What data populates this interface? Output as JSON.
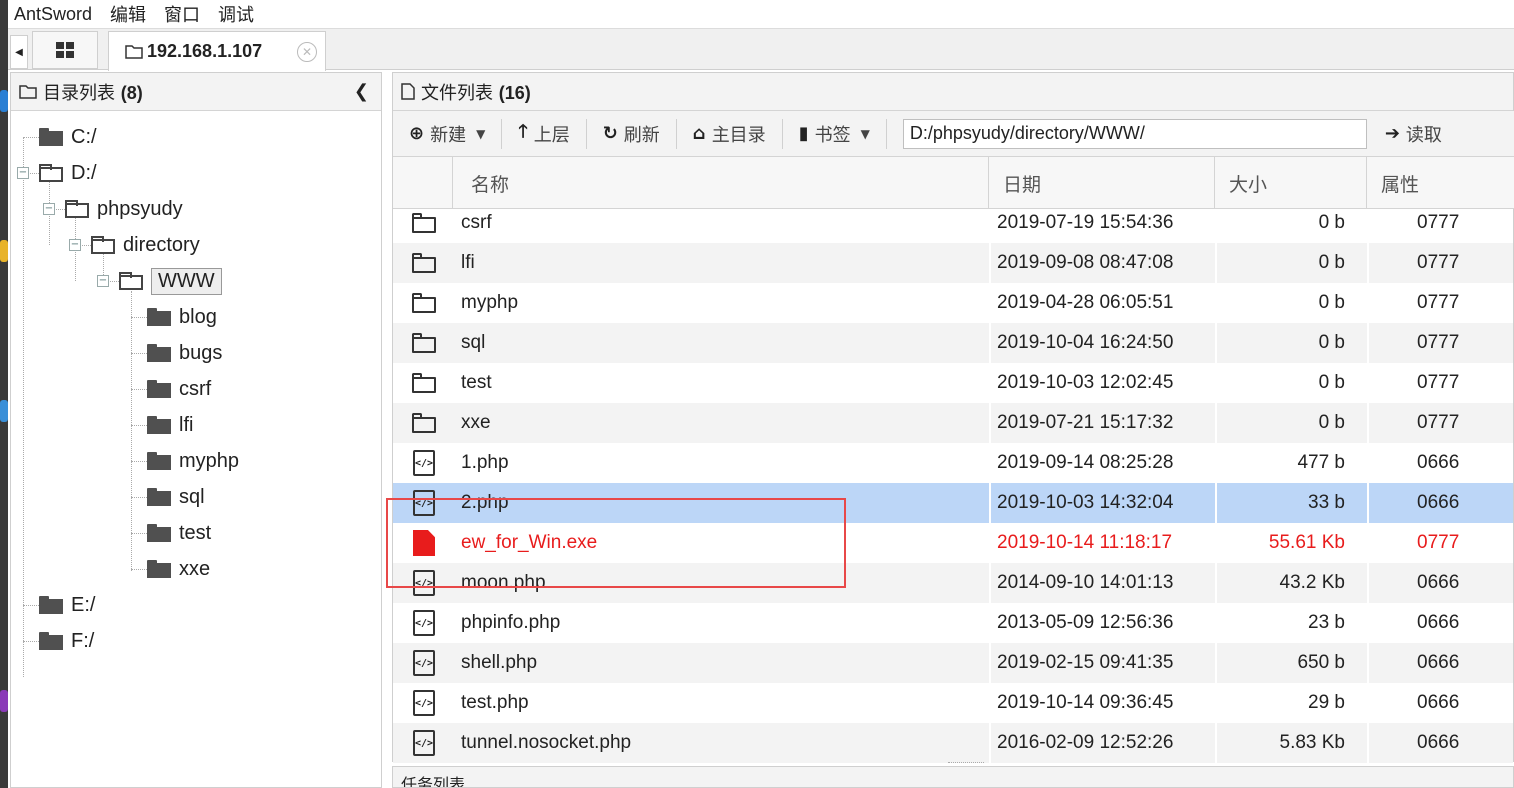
{
  "menu": [
    "AntSword",
    "编辑",
    "窗口",
    "调试"
  ],
  "tabs": {
    "host": "192.168.1.107"
  },
  "left_panel": {
    "title": "目录列表",
    "count": "(8)",
    "tree": [
      {
        "label": "C:/"
      },
      {
        "label": "D:/"
      },
      {
        "label": "phpsyudy"
      },
      {
        "label": "directory"
      },
      {
        "label": "WWW"
      },
      {
        "label": "blog"
      },
      {
        "label": "bugs"
      },
      {
        "label": "csrf"
      },
      {
        "label": "lfi"
      },
      {
        "label": "myphp"
      },
      {
        "label": "sql"
      },
      {
        "label": "test"
      },
      {
        "label": "xxe"
      },
      {
        "label": "E:/"
      },
      {
        "label": "F:/"
      }
    ]
  },
  "right_panel": {
    "title": "文件列表",
    "count": "(16)",
    "toolbar": {
      "new": "新建",
      "up": "上层",
      "refresh": "刷新",
      "home": "主目录",
      "bookmark": "书签",
      "path": "D:/phpsyudy/directory/WWW/",
      "read": "读取"
    },
    "columns": [
      "名称",
      "日期",
      "大小",
      "属性"
    ],
    "files": [
      {
        "name": "csrf",
        "date": "2019-07-19 15:54:36",
        "size": "0 b",
        "attr": "0777",
        "type": "folder"
      },
      {
        "name": "lfi",
        "date": "2019-09-08 08:47:08",
        "size": "0 b",
        "attr": "0777",
        "type": "folder"
      },
      {
        "name": "myphp",
        "date": "2019-04-28 06:05:51",
        "size": "0 b",
        "attr": "0777",
        "type": "folder"
      },
      {
        "name": "sql",
        "date": "2019-10-04 16:24:50",
        "size": "0 b",
        "attr": "0777",
        "type": "folder"
      },
      {
        "name": "test",
        "date": "2019-10-03 12:02:45",
        "size": "0 b",
        "attr": "0777",
        "type": "folder"
      },
      {
        "name": "xxe",
        "date": "2019-07-21 15:17:32",
        "size": "0 b",
        "attr": "0777",
        "type": "folder"
      },
      {
        "name": "1.php",
        "date": "2019-09-14 08:25:28",
        "size": "477 b",
        "attr": "0666",
        "type": "code"
      },
      {
        "name": "2.php",
        "date": "2019-10-03 14:32:04",
        "size": "33 b",
        "attr": "0666",
        "type": "code"
      },
      {
        "name": "ew_for_Win.exe",
        "date": "2019-10-14 11:18:17",
        "size": "55.61 Kb",
        "attr": "0777",
        "type": "exe"
      },
      {
        "name": "moon.php",
        "date": "2014-09-10 14:01:13",
        "size": "43.2 Kb",
        "attr": "0666",
        "type": "code"
      },
      {
        "name": "phpinfo.php",
        "date": "2013-05-09 12:56:36",
        "size": "23 b",
        "attr": "0666",
        "type": "code"
      },
      {
        "name": "shell.php",
        "date": "2019-02-15 09:41:35",
        "size": "650 b",
        "attr": "0666",
        "type": "code"
      },
      {
        "name": "test.php",
        "date": "2019-10-14 09:36:45",
        "size": "29 b",
        "attr": "0666",
        "type": "code"
      },
      {
        "name": "tunnel.nosocket.php",
        "date": "2016-02-09 12:52:26",
        "size": "5.83 Kb",
        "attr": "0666",
        "type": "code"
      }
    ],
    "selected_file": "2.php"
  },
  "tasks": {
    "title": "任务列表"
  },
  "colors": {
    "selected_row": "#bcd6f7",
    "highlight_red": "#e81c1c",
    "annotation": "#e84848"
  }
}
